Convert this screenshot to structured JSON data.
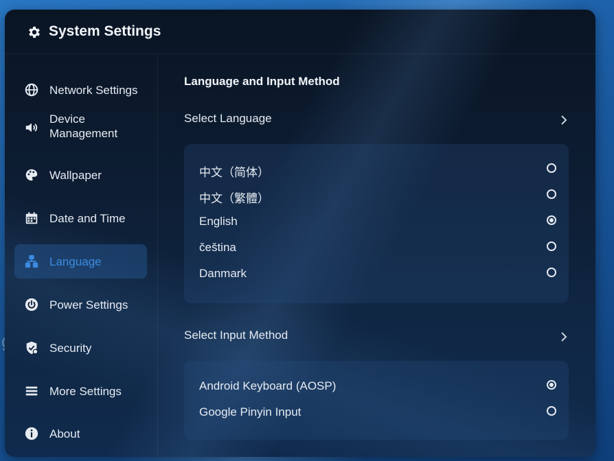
{
  "window": {
    "title": "System Settings",
    "title_icon": "gear-icon"
  },
  "background": {
    "ghost_text": "ge"
  },
  "sidebar": {
    "items": [
      {
        "label": "Network Settings",
        "icon": "globe-icon",
        "active": false
      },
      {
        "label": "Device Management",
        "icon": "speaker-icon",
        "active": false
      },
      {
        "label": "Wallpaper",
        "icon": "palette-icon",
        "active": false
      },
      {
        "label": "Date and Time",
        "icon": "calendar-icon",
        "active": false
      },
      {
        "label": "Language",
        "icon": "language-icon",
        "active": true
      },
      {
        "label": "Power Settings",
        "icon": "power-icon",
        "active": false
      },
      {
        "label": "Security",
        "icon": "shield-icon",
        "active": false
      },
      {
        "label": "More Settings",
        "icon": "list-icon",
        "active": false
      },
      {
        "label": "About",
        "icon": "info-icon",
        "active": false
      }
    ],
    "accent_color": "#3c8be0"
  },
  "main": {
    "heading": "Language and Input Method",
    "select_language": {
      "label": "Select Language",
      "options": [
        {
          "label": "中文（简体）",
          "selected": false
        },
        {
          "label": "中文（繁體）",
          "selected": false
        },
        {
          "label": "English",
          "selected": true
        },
        {
          "label": "čeština",
          "selected": false
        },
        {
          "label": "Danmark",
          "selected": false
        }
      ]
    },
    "select_input_method": {
      "label": "Select Input Method",
      "options": [
        {
          "label": "Android Keyboard (AOSP)",
          "selected": true
        },
        {
          "label": "Google Pinyin Input",
          "selected": false
        }
      ]
    }
  }
}
